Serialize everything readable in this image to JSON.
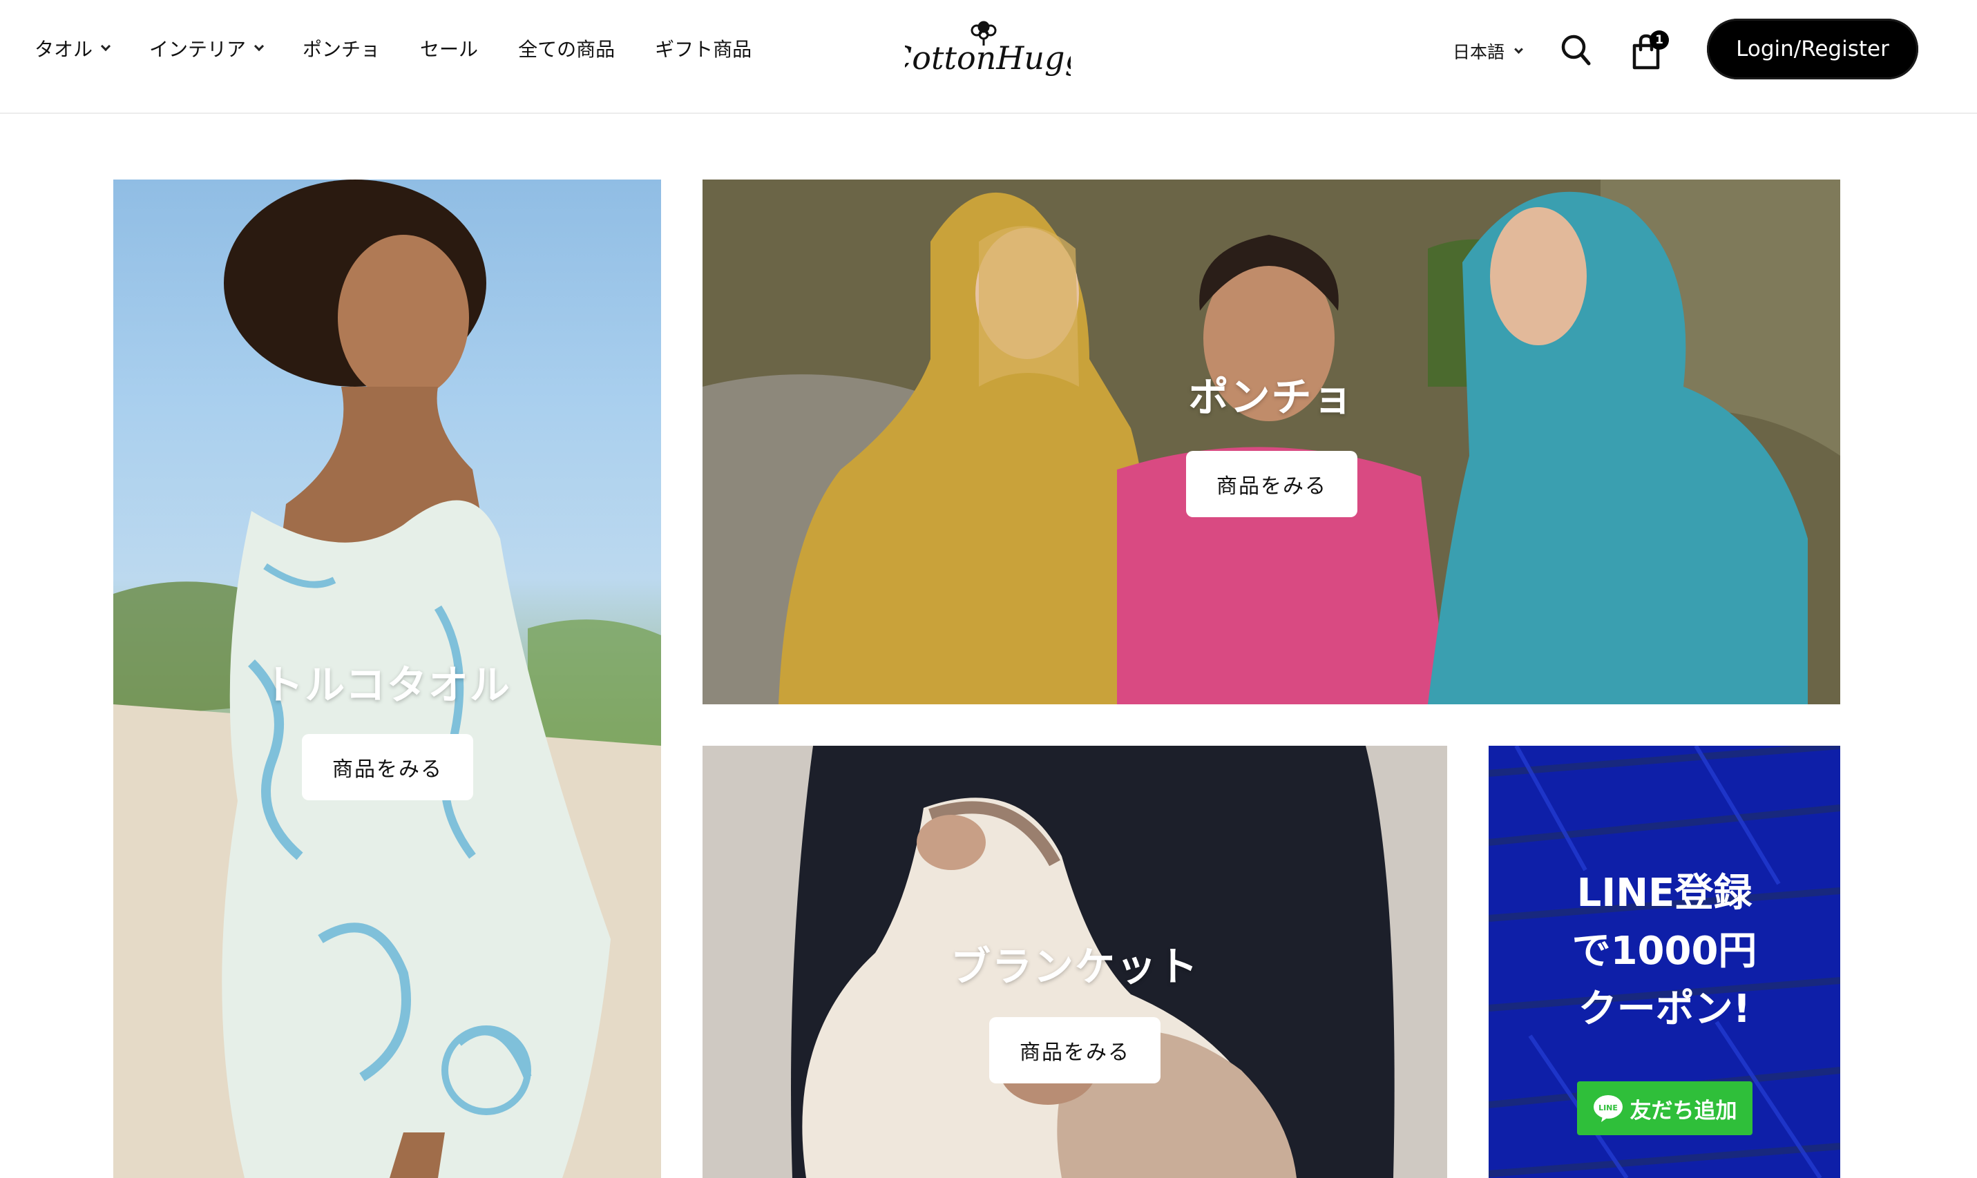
{
  "header": {
    "nav": [
      {
        "label": "タオル",
        "has_dropdown": true
      },
      {
        "label": "インテリア",
        "has_dropdown": true
      },
      {
        "label": "ポンチョ",
        "has_dropdown": false
      },
      {
        "label": "セール",
        "has_dropdown": false
      },
      {
        "label": "全ての商品",
        "has_dropdown": false
      },
      {
        "label": "ギフト商品",
        "has_dropdown": false
      }
    ],
    "logo_text": "CottonHugg",
    "language": "日本語",
    "cart_count": "1",
    "login_label": "Login/Register",
    "icons": [
      "search-icon",
      "cart-icon",
      "chevron-down-icon",
      "cotton-flower-icon"
    ]
  },
  "tiles": {
    "towel": {
      "title": "トルコタオル",
      "button": "商品をみる"
    },
    "poncho": {
      "title": "ポンチョ",
      "button": "商品をみる"
    },
    "blanket": {
      "title": "ブランケット",
      "button": "商品をみる"
    },
    "line": {
      "lines": [
        "LINE登録",
        "で1000円",
        "クーポン!"
      ],
      "button": "友だち追加",
      "icon_label": "LINE"
    }
  },
  "colors": {
    "login_bg": "#000000",
    "line_tile_bg": "#0e1fa8",
    "line_button_bg": "#2fbf3a",
    "cart_badge_bg": "#000000"
  }
}
